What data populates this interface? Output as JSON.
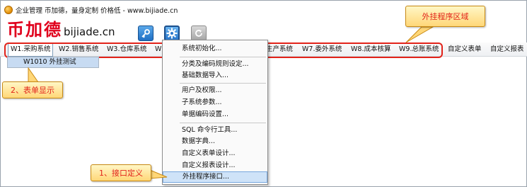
{
  "window": {
    "title": "企业管理 币加德，量身定制 价格低 - www.bijiade.cn",
    "brand_cn": "币加德",
    "brand_en": "bijiade.cn"
  },
  "toolbar": {
    "icons": [
      "key-icon",
      "gear-icon",
      "refresh-icon"
    ]
  },
  "menubar": {
    "items": [
      {
        "label": "W1.采购系统"
      },
      {
        "label": "W2.销售系统"
      },
      {
        "label": "W3.仓库系统"
      },
      {
        "label": "W"
      },
      {
        "label": "生产系统"
      },
      {
        "label": "W7.委外系统"
      },
      {
        "label": "W8.成本核算"
      },
      {
        "label": "W9.总账系统"
      },
      {
        "label": "自定义表单"
      },
      {
        "label": "自定义报表"
      }
    ],
    "open_submenu": {
      "item": "W1010 外挂测试"
    }
  },
  "settings_menu": {
    "items": [
      "系统初始化...",
      "分类及编码规则设定...",
      "基础数据导入...",
      "用户及权限...",
      "子系统参数...",
      "单据编码设置...",
      "SQL 命令行工具...",
      "数据字典...",
      "自定义表单设计...",
      "自定义报表设计...",
      "外挂程序接口..."
    ],
    "highlighted": "外挂程序接口..."
  },
  "callouts": {
    "plugin_region": "外挂程序区域",
    "form_display": "2、表单显示",
    "interface_def": "1、接口定义"
  },
  "colors": {
    "brand_red": "#e0001c",
    "annotation_red": "#e2231a",
    "callout_fill": "#ffd778",
    "menu_highlight": "#cfe3f8"
  }
}
